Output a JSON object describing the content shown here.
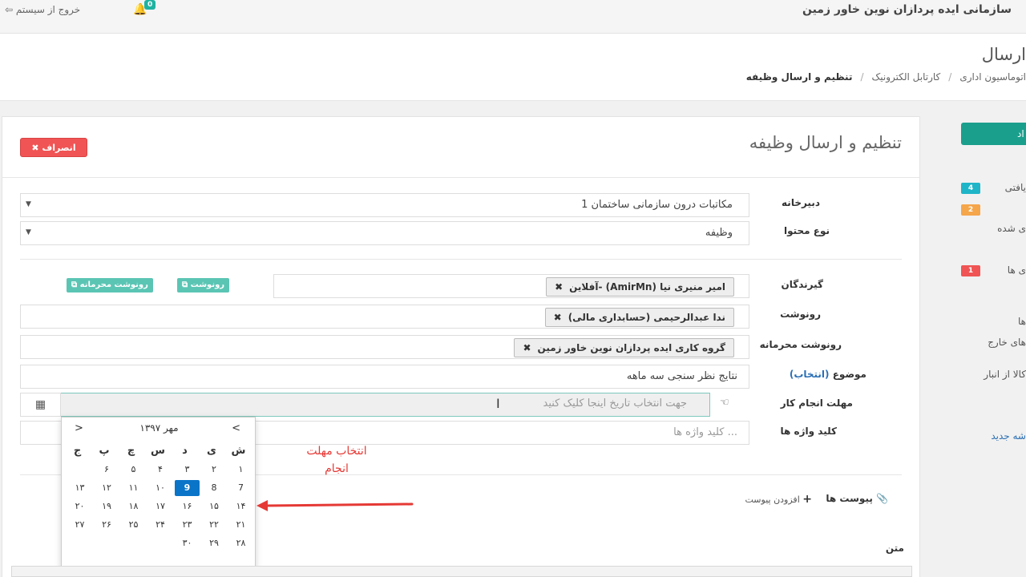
{
  "topbar": {
    "company": "سازمانی ایده پردازان نوین خاور زمین",
    "logout_label": "خروج از سیستم",
    "notification_count": "0"
  },
  "page_header": {
    "title": "ارسال",
    "breadcrumb": [
      "اتوماسیون اداری",
      "کارتابل الکترونیک",
      "تنظیم و ارسال وظیفه"
    ]
  },
  "panel": {
    "title": "تنظیم و ارسال وظیفه",
    "cancel_label": "انصراف"
  },
  "form": {
    "secretariat": {
      "label": "دبیرخانه",
      "value": "مکاتبات درون سازمانی ساختمان 1"
    },
    "content_type": {
      "label": "نوع محتوا",
      "value": "وظیفه"
    },
    "recipients": {
      "label": "گیرندگان",
      "tag": "امیر منیری نیا (AmirMn) -آفلاین"
    },
    "cc": {
      "label": "رونوشت",
      "tag": "ندا عبدالرحیمی (حسابداری مالی)"
    },
    "confidential_cc": {
      "label": "رونوشت محرمانه",
      "tag": "گروه کاری ایده پردازان نوین خاور زمین"
    },
    "cc_button": "رونوشت",
    "confidential_cc_button": "رونوشت محرمانه",
    "subject": {
      "label": "موضوع",
      "select_link": "(انتخاب)",
      "value": "نتایج نظر سنجی سه ماهه"
    },
    "deadline": {
      "label": "مهلت انجام کار",
      "placeholder": "جهت انتخاب تاریخ اینجا کلیک کنید"
    },
    "keywords": {
      "label": "کلید واژه ها",
      "placeholder": "کلید واژه ها ..."
    }
  },
  "datepicker": {
    "month_label": "مهر ۱۳۹۷",
    "prev": "<",
    "next": ">",
    "weekdays": [
      "ش",
      "ی",
      "د",
      "س",
      "چ",
      "پ",
      "ج"
    ],
    "weeks": [
      [
        "۱",
        "۲",
        "۳",
        "۴",
        "۵",
        "۶"
      ],
      [
        "7",
        "8",
        "9",
        "۱۰",
        "۱۱",
        "۱۲",
        "۱۳"
      ],
      [
        "۱۴",
        "۱۵",
        "۱۶",
        "۱۷",
        "۱۸",
        "۱۹",
        "۲۰"
      ],
      [
        "۲۱",
        "۲۲",
        "۲۳",
        "۲۴",
        "۲۵",
        "۲۶",
        "۲۷"
      ],
      [
        "۲۸",
        "۲۹",
        "۳۰"
      ]
    ],
    "today": "9"
  },
  "annotation": {
    "line1": "انتخاب مهلت",
    "line2": "انجام"
  },
  "attachments": {
    "label": "پیوست ها",
    "add_label": "افزودن پیوست"
  },
  "body_label": "متن",
  "sidebar": {
    "button": "اد",
    "items": [
      {
        "text": "یافتی",
        "badge": "4",
        "color": "#1fb5c8"
      },
      {
        "text": "",
        "badge": "2",
        "color": "#f5a54a"
      },
      {
        "text": "ی شده",
        "badge": "",
        "color": ""
      },
      {
        "text": "ی ها",
        "badge": "1",
        "color": "#f05454"
      }
    ],
    "links": [
      "ها",
      "های خارج",
      "کالا از انبار",
      "شه جدید"
    ]
  },
  "colors": {
    "accent": "#1a9f8c",
    "danger": "#f05454",
    "today": "#0a74c8",
    "annotation": "#e53935"
  }
}
